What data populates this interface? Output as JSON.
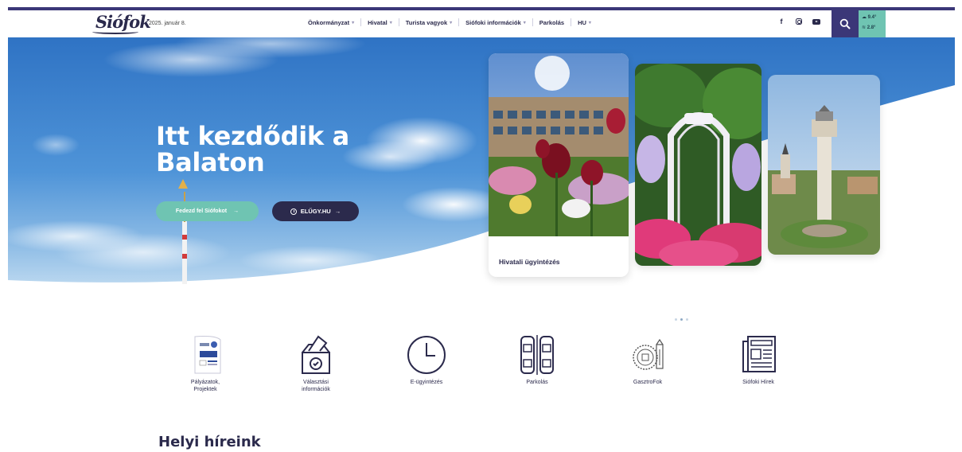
{
  "header": {
    "logo_text": "Siófok",
    "date": "2025. január 8.",
    "nav": [
      {
        "label": "Önkormányzat",
        "has_dropdown": true
      },
      {
        "label": "Hivatal",
        "has_dropdown": true
      },
      {
        "label": "Turista vagyok",
        "has_dropdown": true
      },
      {
        "label": "Siófoki információk",
        "has_dropdown": true
      },
      {
        "label": "Parkolás",
        "has_dropdown": false
      },
      {
        "label": "HU",
        "has_dropdown": true
      }
    ],
    "social_icons": [
      "facebook-icon",
      "instagram-icon",
      "youtube-icon"
    ],
    "weather": {
      "sky_temp": "9.4°",
      "water_temp": "2.8°"
    }
  },
  "hero": {
    "title_line1": "Itt kezdődik a",
    "title_line2": "Balaton",
    "btn_discover": "Fedezd fel Siófokot",
    "btn_elugy": "ELŰGY.HU",
    "arrow": "→",
    "cards": [
      {
        "caption": "Hivatali ügyintézés"
      },
      {
        "caption": ""
      },
      {
        "caption": ""
      }
    ],
    "carousel_dots": 3,
    "active_dot": 2
  },
  "quick_links": [
    {
      "label": "Pályázatok,\nProjektek",
      "icon": "projects-icon"
    },
    {
      "label": "Választási\ninformációk",
      "icon": "ballot-box-icon"
    },
    {
      "label": "E-ügyintézés",
      "icon": "clock-icon"
    },
    {
      "label": "Parkolás",
      "icon": "parking-cars-icon"
    },
    {
      "label": "GasztroFok",
      "icon": "gastro-stamp-icon"
    },
    {
      "label": "Siófoki Hírek",
      "icon": "newspaper-icon"
    }
  ],
  "news_section": {
    "title": "Helyi híreink"
  },
  "colors": {
    "primary": "#2b2a4c",
    "accent": "#6fc4b2",
    "navy": "#3b3778"
  }
}
